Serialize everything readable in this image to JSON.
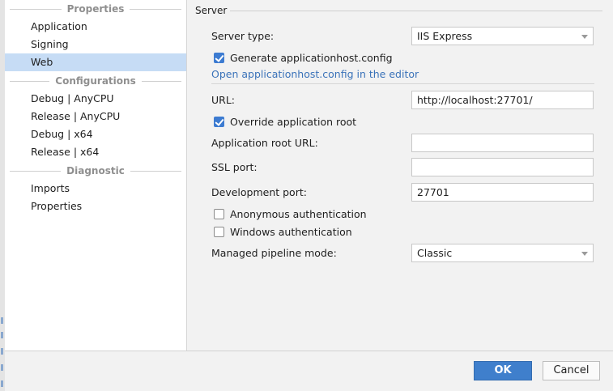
{
  "sidebar": {
    "sections": [
      {
        "title": "Properties",
        "items": [
          "Application",
          "Signing",
          "Web"
        ]
      },
      {
        "title": "Configurations",
        "items": [
          "Debug | AnyCPU",
          "Release | AnyCPU",
          "Debug | x64",
          "Release | x64"
        ]
      },
      {
        "title": "Diagnostic",
        "items": [
          "Imports",
          "Properties"
        ]
      }
    ],
    "selected": "Web"
  },
  "server": {
    "group_title": "Server",
    "server_type_label": "Server type:",
    "server_type_value": "IIS Express",
    "generate_config_label": "Generate applicationhost.config",
    "generate_config_checked": true,
    "open_config_link": "Open applicationhost.config in the editor",
    "url_label": "URL:",
    "url_value": "http://localhost:27701/",
    "override_root_label": "Override application root",
    "override_root_checked": true,
    "app_root_url_label": "Application root URL:",
    "app_root_url_value": "",
    "ssl_port_label": "SSL port:",
    "ssl_port_value": "",
    "dev_port_label": "Development port:",
    "dev_port_value": "27701",
    "anonymous_auth_label": "Anonymous authentication",
    "anonymous_auth_checked": false,
    "windows_auth_label": "Windows authentication",
    "windows_auth_checked": false,
    "pipeline_mode_label": "Managed pipeline mode:",
    "pipeline_mode_value": "Classic"
  },
  "footer": {
    "ok_label": "OK",
    "cancel_label": "Cancel"
  },
  "colors": {
    "accent": "#3f7fcc",
    "selection": "#c6dcf5",
    "link": "#3b73b9"
  }
}
